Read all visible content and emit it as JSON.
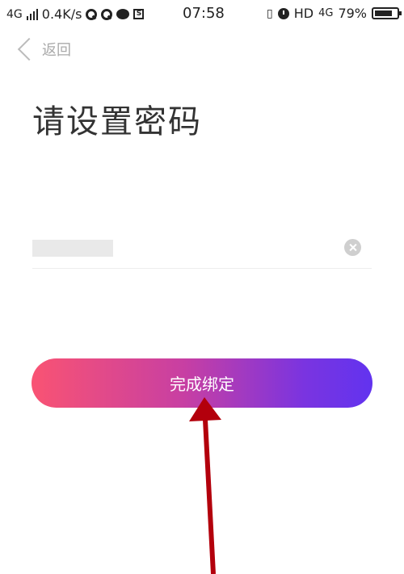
{
  "status_bar": {
    "network": "4G",
    "speed": "0.4K/s",
    "time": "07:58",
    "hd": "HD",
    "net_right": "4G",
    "battery": "79%",
    "battery_level": 0.79
  },
  "header": {
    "back_label": "返回"
  },
  "main": {
    "title": "请设置密码",
    "submit_label": "完成绑定"
  },
  "colors": {
    "button_gradient_start": "#f95373",
    "button_gradient_end": "#6233ef",
    "annotation_arrow": "#b3000c"
  }
}
